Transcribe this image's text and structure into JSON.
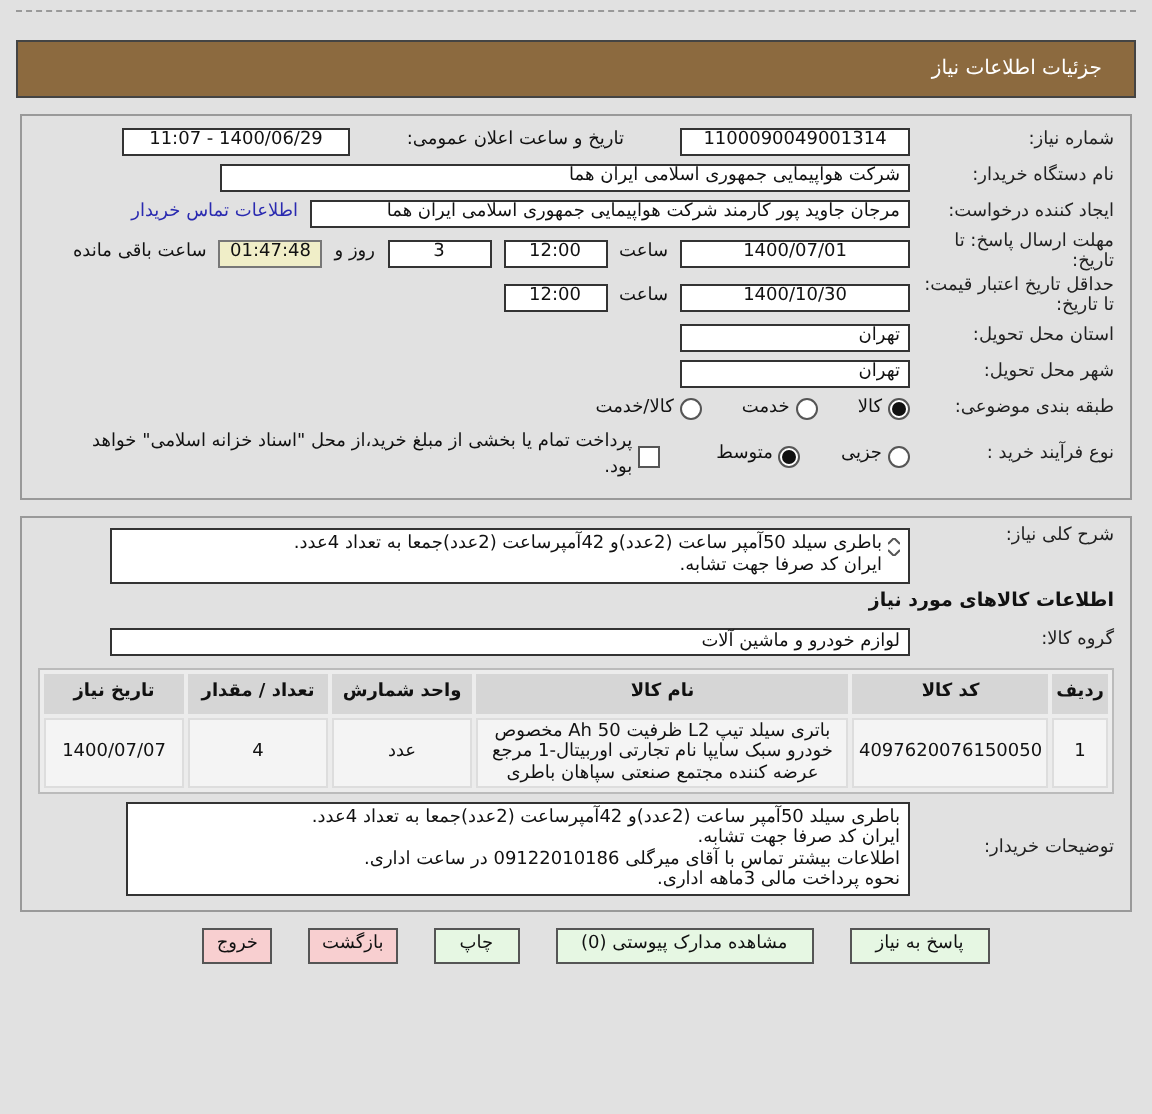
{
  "header": {
    "title": "جزئیات اطلاعات نیاز"
  },
  "details": {
    "need_number": {
      "label": "شماره نیاز:",
      "value": "1100090049001314"
    },
    "announce": {
      "label": "تاریخ و ساعت اعلان عمومی:",
      "value": "1400/06/29 - 11:07"
    },
    "buyer_org": {
      "label": "نام دستگاه خریدار:",
      "value": "شرکت هواپیمایی جمهوری اسلامی ایران هما"
    },
    "creator": {
      "label": "ایجاد کننده درخواست:",
      "value": "مرجان جاوید پور کارمند شرکت هواپیمایی جمهوری اسلامی ایران هما",
      "link": "اطلاعات تماس خریدار"
    },
    "deadline": {
      "label": "مهلت ارسال پاسخ: تا تاریخ:",
      "date": "1400/07/01",
      "time_label": "ساعت",
      "time": "12:00",
      "days": "3",
      "days_label": "روز و",
      "remaining": "01:47:48",
      "remaining_label": "ساعت باقی مانده"
    },
    "validity": {
      "label": "حداقل تاریخ اعتبار قیمت: تا تاریخ:",
      "date": "1400/10/30",
      "time_label": "ساعت",
      "time": "12:00"
    },
    "province": {
      "label": "استان محل تحویل:",
      "value": "تهران"
    },
    "city": {
      "label": "شهر محل تحویل:",
      "value": "تهران"
    },
    "category": {
      "label": "طبقه بندی موضوعی:",
      "options": [
        {
          "label": "کالا",
          "selected": true
        },
        {
          "label": "خدمت",
          "selected": false
        },
        {
          "label": "کالا/خدمت",
          "selected": false
        }
      ]
    },
    "process": {
      "label": "نوع فرآیند خرید :",
      "options": [
        {
          "label": "جزیی",
          "selected": false
        },
        {
          "label": "متوسط",
          "selected": true
        }
      ],
      "treasury": {
        "label": "پرداخت تمام یا بخشی از مبلغ خرید،از محل \"اسناد خزانه اسلامی\" خواهد بود.",
        "checked": false
      }
    }
  },
  "goods": {
    "summary": {
      "label": "شرح کلی نیاز:",
      "lines": [
        "باطری سیلد 50آمپر ساعت (2عدد)و 42آمپرساعت (2عدد)جمعا به تعداد 4عدد.",
        "ایران کد صرفا جهت تشابه."
      ]
    },
    "heading": "اطلاعات کالاهای مورد نیاز",
    "group": {
      "label": "گروه کالا:",
      "value": "لوازم خودرو و ماشین آلات"
    },
    "table": {
      "columns": [
        "ردیف",
        "کد کالا",
        "نام کالا",
        "واحد شمارش",
        "تعداد / مقدار",
        "تاریخ نیاز"
      ],
      "rows": [
        [
          "1",
          "4097620076150050",
          "باتری سیلد تیپ L2 ظرفیت 50 Ah مخصوص خودرو سبک سایپا نام تجارتی اوربیتال-1 مرجع عرضه کننده مجتمع صنعتی سپاهان باطری",
          "عدد",
          "4",
          "1400/07/07"
        ]
      ]
    },
    "notes": {
      "label": "توضیحات خریدار:",
      "lines": [
        "باطری سیلد 50آمپر ساعت (2عدد)و 42آمپرساعت (2عدد)جمعا به تعداد 4عدد.",
        "ایران کد صرفا جهت تشابه.",
        "اطلاعات بیشتر تماس با آقای میرگلی 09122010186 در ساعت اداری.",
        "نحوه پرداخت مالی 3ماهه اداری."
      ]
    }
  },
  "buttons": [
    {
      "label": "پاسخ به نیاز",
      "kind": "normal"
    },
    {
      "label": "مشاهده مدارک پیوستی (0)",
      "kind": "normal"
    },
    {
      "label": "چاپ",
      "kind": "normal"
    },
    {
      "label": "بازگشت",
      "kind": "exit"
    },
    {
      "label": "خروج",
      "kind": "exit"
    }
  ]
}
